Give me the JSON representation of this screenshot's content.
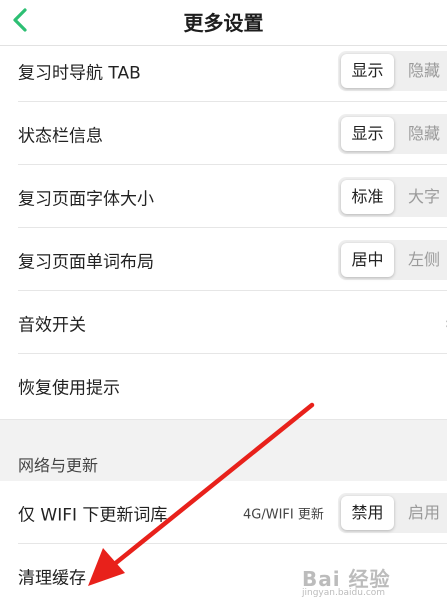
{
  "header": {
    "title": "更多设置"
  },
  "rows": [
    {
      "label": "复习时导航 TAB",
      "on": "显示",
      "off": "隐藏"
    },
    {
      "label": "状态栏信息",
      "on": "显示",
      "off": "隐藏"
    },
    {
      "label": "复习页面字体大小",
      "on": "标准",
      "off": "大字"
    },
    {
      "label": "复习页面单词布局",
      "on": "居中",
      "off": "左侧"
    },
    {
      "label": "音效开关"
    },
    {
      "label": "恢复使用提示"
    }
  ],
  "section": {
    "title": "网络与更新"
  },
  "wifi_row": {
    "label": "仅 WIFI 下更新词库",
    "note": "4G/WIFI 更新",
    "on": "禁用",
    "off": "启用"
  },
  "cache_row": {
    "label": "清理缓存"
  },
  "watermark": {
    "brand": "Bai 经验",
    "url": "jingyan.baidu.com"
  },
  "colors": {
    "back": "#2dbf73",
    "arrow": "#e8211b",
    "segment": "#efefef"
  }
}
